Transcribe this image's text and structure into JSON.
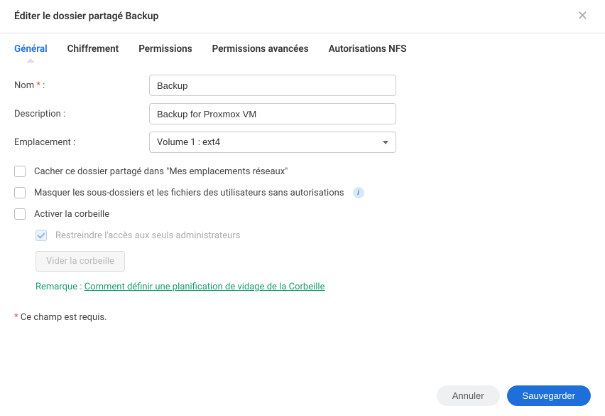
{
  "header": {
    "title": "Éditer le dossier partagé Backup"
  },
  "tabs": {
    "general": "Général",
    "encryption": "Chiffrement",
    "permissions": "Permissions",
    "adv_permissions": "Permissions avancées",
    "nfs": "Autorisations NFS"
  },
  "fields": {
    "name_label": "Nom",
    "name_colon": ":",
    "name_value": "Backup",
    "desc_label": "Description :",
    "desc_value": "Backup for Proxmox VM",
    "location_label": "Emplacement :",
    "location_value": "Volume 1 :  ext4"
  },
  "checkboxes": {
    "hide_network": "Cacher ce dossier partagé dans \"Mes emplacements réseaux\"",
    "hide_sub": "Masquer les sous-dossiers et les fichiers des utilisateurs sans autorisations",
    "recycle": "Activer la corbeille",
    "restrict_admin": "Restreindre l'accès aux seuls administrateurs"
  },
  "buttons": {
    "empty_trash": "Vider la corbeille",
    "cancel": "Annuler",
    "save": "Sauvegarder"
  },
  "remark": {
    "prefix": "Remarque : ",
    "link": "Comment définir une planification de vidage de la Corbeille"
  },
  "required_note": {
    "star": "*",
    "text": " Ce champ est requis."
  }
}
